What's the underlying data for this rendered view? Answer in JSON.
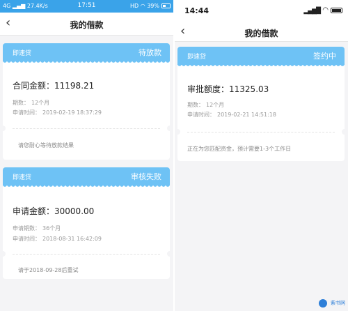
{
  "left": {
    "status": {
      "network": "4G",
      "speed": "27.4K/s",
      "time": "17:51",
      "hd": "HD",
      "battery": "39%",
      "battery_level": 0.39
    },
    "nav": {
      "title": "我的借款"
    },
    "cards": [
      {
        "product": "即速贷",
        "status": "待放款",
        "amount_label": "合同金额：",
        "amount_value": "11198.21",
        "meta": [
          {
            "label": "期数：",
            "value": "12个月"
          },
          {
            "label": "申请时间：",
            "value": "2019-02-19 18:37:29"
          }
        ],
        "footer": "请您耐心等待放款结果"
      },
      {
        "product": "即速贷",
        "status": "审核失败",
        "amount_label": "申请金额：",
        "amount_value": "30000.00",
        "meta": [
          {
            "label": "申请期数：",
            "value": "36个月"
          },
          {
            "label": "申请时间：",
            "value": "2018-08-31 16:42:09"
          }
        ],
        "footer": "请于2018-09-28后重试"
      }
    ]
  },
  "right": {
    "status": {
      "time": "14:44"
    },
    "nav": {
      "title": "我的借款"
    },
    "cards": [
      {
        "product": "即速贷",
        "status": "签约中",
        "amount_label": "审批额度：",
        "amount_value": "11325.03",
        "meta": [
          {
            "label": "期数：",
            "value": "12个月"
          },
          {
            "label": "申请时间：",
            "value": "2019-02-21 14:51:18"
          }
        ],
        "footer": "正在为您匹配资金，预计需要1-3个工作日"
      }
    ]
  },
  "watermark": {
    "text": "紫书网",
    "logo_text": "Ki"
  },
  "colors": {
    "accent": "#3aa3e9",
    "card_header": "#6ec2f5",
    "background": "#f4f4f6"
  }
}
